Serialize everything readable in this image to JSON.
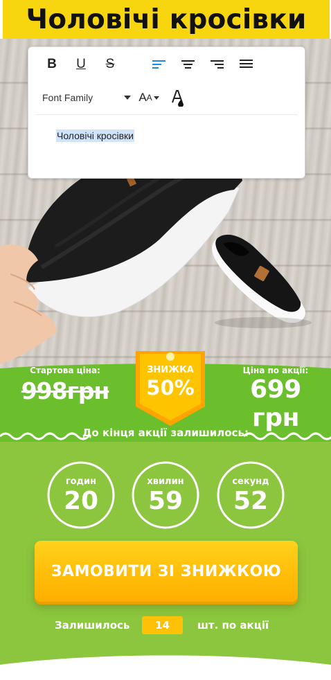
{
  "header": {
    "title": "Чоловічі кросівки"
  },
  "editor": {
    "toolbar": {
      "bold_label": "B",
      "underline_label": "U",
      "strike_label": "S",
      "font_family": "Font Family",
      "size_label_big": "A",
      "size_label_small": "A"
    },
    "content_text": "Чоловічі кросівки",
    "selection_color": "#cfe3fb",
    "active_icon_color": "#1e88e5"
  },
  "offer": {
    "start_price_label": "Стартова ціна:",
    "start_price": "998грн",
    "discount_label": "ЗНИЖКА",
    "discount_value": "50%",
    "promo_price_label": "Ціна по акції:",
    "promo_price": "699 грн",
    "countdown_caption": "До кінця акції залишилось:"
  },
  "countdown": [
    {
      "label": "годин",
      "value": "20"
    },
    {
      "label": "хвилин",
      "value": "59"
    },
    {
      "label": "секунд",
      "value": "52"
    }
  ],
  "cta": {
    "label": "ЗАМОВИТИ ЗІ ЗНИЖКОЮ"
  },
  "stock": {
    "prefix": "Залишилось",
    "count": "14",
    "suffix": "шт. по акції"
  },
  "colors": {
    "banner_yellow": "#f7d50f",
    "green_dark": "#6cbf2c",
    "green_light": "#8cc63e",
    "badge_yellow": "#ffc107",
    "button_orange": "#ffbd0a"
  }
}
